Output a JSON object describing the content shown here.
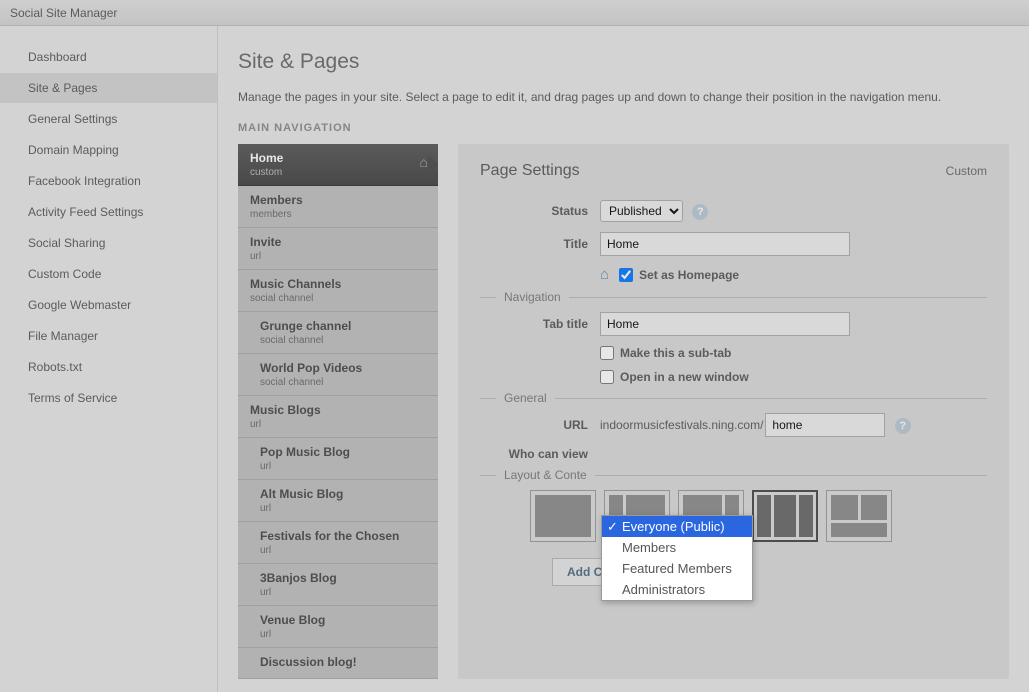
{
  "app_title": "Social Site Manager",
  "sidebar": {
    "items": [
      {
        "label": "Dashboard"
      },
      {
        "label": "Site & Pages",
        "active": true
      },
      {
        "label": "General Settings"
      },
      {
        "label": "Domain Mapping"
      },
      {
        "label": "Facebook Integration"
      },
      {
        "label": "Activity Feed Settings"
      },
      {
        "label": "Social Sharing"
      },
      {
        "label": "Custom Code"
      },
      {
        "label": "Google Webmaster"
      },
      {
        "label": "File Manager"
      },
      {
        "label": "Robots.txt"
      },
      {
        "label": "Terms of Service"
      }
    ]
  },
  "page": {
    "title": "Site & Pages",
    "description": "Manage the pages in your site. Select a page to edit it, and drag pages up and down to change their position in the navigation menu.",
    "section_label": "MAIN NAVIGATION"
  },
  "navlist": [
    {
      "title": "Home",
      "sub": "custom",
      "selected": true,
      "home_icon": true
    },
    {
      "title": "Members",
      "sub": "members"
    },
    {
      "title": "Invite",
      "sub": "url"
    },
    {
      "title": "Music Channels",
      "sub": "social channel"
    },
    {
      "title": "Grunge channel",
      "sub": "social channel",
      "child": true
    },
    {
      "title": "World Pop Videos",
      "sub": "social channel",
      "child": true
    },
    {
      "title": "Music Blogs",
      "sub": "url"
    },
    {
      "title": "Pop Music Blog",
      "sub": "url",
      "child": true
    },
    {
      "title": "Alt Music Blog",
      "sub": "url",
      "child": true
    },
    {
      "title": "Festivals for the Chosen",
      "sub": "url",
      "child": true
    },
    {
      "title": "3Banjos Blog",
      "sub": "url",
      "child": true
    },
    {
      "title": "Venue Blog",
      "sub": "url",
      "child": true
    },
    {
      "title": "Discussion blog!",
      "sub": "",
      "child": true
    }
  ],
  "panel": {
    "heading": "Page Settings",
    "type": "Custom",
    "status_label": "Status",
    "status_value": "Published",
    "title_label": "Title",
    "title_value": "Home",
    "homepage_label": "Set as Homepage",
    "nav_legend": "Navigation",
    "tab_label": "Tab title",
    "tab_value": "Home",
    "subtab_label": "Make this a sub-tab",
    "newwin_label": "Open in a new window",
    "gen_legend": "General",
    "url_label": "URL",
    "url_prefix": "indoormusicfestivals.ning.com/",
    "url_value": "home",
    "view_label": "Who can view",
    "layout_legend": "Layout & Conte",
    "add_label": "Add Content"
  },
  "dropdown": {
    "options": [
      {
        "label": "Everyone (Public)",
        "selected": true
      },
      {
        "label": "Members"
      },
      {
        "label": "Featured Members"
      },
      {
        "label": "Administrators"
      }
    ]
  }
}
